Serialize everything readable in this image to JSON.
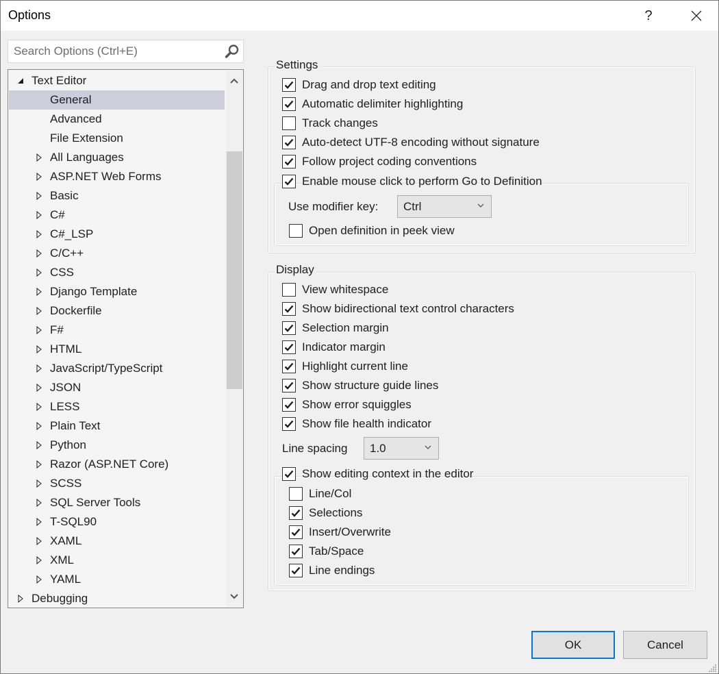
{
  "window": {
    "title": "Options",
    "help_label": "?",
    "close_label": "✕"
  },
  "search": {
    "placeholder": "Search Options (Ctrl+E)",
    "value": "",
    "icon": "search-icon"
  },
  "tree": {
    "items": [
      {
        "label": "Text Editor",
        "level": 0,
        "state": "expanded"
      },
      {
        "label": "General",
        "level": 1,
        "state": "leaf",
        "selected": true
      },
      {
        "label": "Advanced",
        "level": 1,
        "state": "leaf"
      },
      {
        "label": "File Extension",
        "level": 1,
        "state": "leaf"
      },
      {
        "label": "All Languages",
        "level": 1,
        "state": "collapsed"
      },
      {
        "label": "ASP.NET Web Forms",
        "level": 1,
        "state": "collapsed"
      },
      {
        "label": "Basic",
        "level": 1,
        "state": "collapsed"
      },
      {
        "label": "C#",
        "level": 1,
        "state": "collapsed"
      },
      {
        "label": "C#_LSP",
        "level": 1,
        "state": "collapsed"
      },
      {
        "label": "C/C++",
        "level": 1,
        "state": "collapsed"
      },
      {
        "label": "CSS",
        "level": 1,
        "state": "collapsed"
      },
      {
        "label": "Django Template",
        "level": 1,
        "state": "collapsed"
      },
      {
        "label": "Dockerfile",
        "level": 1,
        "state": "collapsed"
      },
      {
        "label": "F#",
        "level": 1,
        "state": "collapsed"
      },
      {
        "label": "HTML",
        "level": 1,
        "state": "collapsed"
      },
      {
        "label": "JavaScript/TypeScript",
        "level": 1,
        "state": "collapsed"
      },
      {
        "label": "JSON",
        "level": 1,
        "state": "collapsed"
      },
      {
        "label": "LESS",
        "level": 1,
        "state": "collapsed"
      },
      {
        "label": "Plain Text",
        "level": 1,
        "state": "collapsed"
      },
      {
        "label": "Python",
        "level": 1,
        "state": "collapsed"
      },
      {
        "label": "Razor (ASP.NET Core)",
        "level": 1,
        "state": "collapsed"
      },
      {
        "label": "SCSS",
        "level": 1,
        "state": "collapsed"
      },
      {
        "label": "SQL Server Tools",
        "level": 1,
        "state": "collapsed"
      },
      {
        "label": "T-SQL90",
        "level": 1,
        "state": "collapsed"
      },
      {
        "label": "XAML",
        "level": 1,
        "state": "collapsed"
      },
      {
        "label": "XML",
        "level": 1,
        "state": "collapsed"
      },
      {
        "label": "YAML",
        "level": 1,
        "state": "collapsed"
      },
      {
        "label": "Debugging",
        "level": 0,
        "state": "collapsed"
      }
    ],
    "scroll_position": 0.18,
    "scroll_visible_fraction": 0.48
  },
  "settings": {
    "title": "Settings",
    "checkboxes": [
      {
        "label": "Drag and drop text editing",
        "checked": true
      },
      {
        "label": "Automatic delimiter highlighting",
        "checked": true
      },
      {
        "label": "Track changes",
        "checked": false
      },
      {
        "label": "Auto-detect UTF-8 encoding without signature",
        "checked": true
      },
      {
        "label": "Follow project coding conventions",
        "checked": true
      }
    ],
    "goto_def": {
      "label": "Enable mouse click to perform Go to Definition",
      "checked": true,
      "modifier_label": "Use modifier key:",
      "modifier_value": "Ctrl",
      "peek": {
        "label": "Open definition in peek view",
        "checked": false
      }
    }
  },
  "display": {
    "title": "Display",
    "checkboxes": [
      {
        "label": "View whitespace",
        "checked": false
      },
      {
        "label": "Show bidirectional text control characters",
        "checked": true
      },
      {
        "label": "Selection margin",
        "checked": true
      },
      {
        "label": "Indicator margin",
        "checked": true
      },
      {
        "label": "Highlight current line",
        "checked": true
      },
      {
        "label": "Show structure guide lines",
        "checked": true
      },
      {
        "label": "Show error squiggles",
        "checked": true
      },
      {
        "label": "Show file health indicator",
        "checked": true
      }
    ],
    "line_spacing_label": "Line spacing",
    "line_spacing_value": "1.0",
    "editing_context": {
      "label": "Show editing context in the editor",
      "checked": true,
      "items": [
        {
          "label": "Line/Col",
          "checked": false
        },
        {
          "label": "Selections",
          "checked": true
        },
        {
          "label": "Insert/Overwrite",
          "checked": true
        },
        {
          "label": "Tab/Space",
          "checked": true
        },
        {
          "label": "Line endings",
          "checked": true
        }
      ]
    }
  },
  "buttons": {
    "ok": "OK",
    "cancel": "Cancel"
  },
  "colors": {
    "selection": "#cccedb",
    "focus_border": "#0078d7",
    "scroll_thumb": "#cdcdcd"
  }
}
